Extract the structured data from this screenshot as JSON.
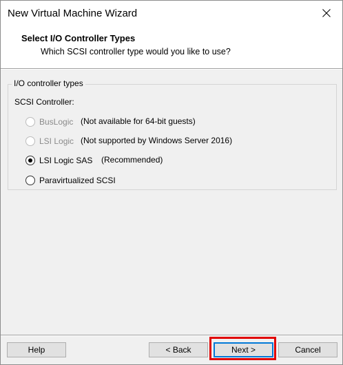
{
  "window": {
    "title": "New Virtual Machine Wizard"
  },
  "header": {
    "title": "Select I/O Controller Types",
    "subtitle": "Which SCSI controller type would you like to use?"
  },
  "group": {
    "legend": "I/O controller types",
    "scsi_label": "SCSI Controller:",
    "options": [
      {
        "label": "BusLogic",
        "note": "(Not available for 64-bit guests)",
        "enabled": false,
        "selected": false
      },
      {
        "label": "LSI Logic",
        "note": "(Not supported by Windows Server 2016)",
        "enabled": false,
        "selected": false
      },
      {
        "label": "LSI Logic SAS",
        "note": "(Recommended)",
        "enabled": true,
        "selected": true
      },
      {
        "label": "Paravirtualized SCSI",
        "note": "",
        "enabled": true,
        "selected": false
      }
    ]
  },
  "buttons": {
    "help": "Help",
    "back": "< Back",
    "next": "Next >",
    "cancel": "Cancel"
  },
  "colors": {
    "highlight": "#e00000",
    "default_button_border": "#0078d7"
  }
}
